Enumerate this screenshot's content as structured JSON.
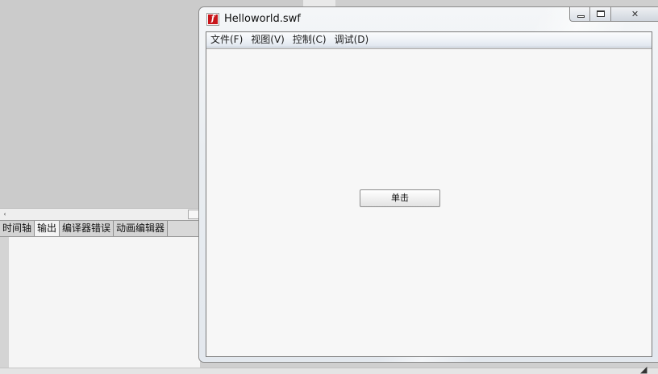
{
  "ide": {
    "scroll_left_arrow": "‹",
    "tabs": [
      {
        "label": "时间轴",
        "active": false
      },
      {
        "label": "输出",
        "active": true
      },
      {
        "label": "编译器错误",
        "active": false
      },
      {
        "label": "动画编辑器",
        "active": false
      }
    ],
    "resize_grip": "◢"
  },
  "swf_window": {
    "title": "Helloworld.swf",
    "icon": "flash-player-icon",
    "controls": {
      "minimize": "minimize-icon",
      "maximize": "maximize-icon",
      "close": "close-icon",
      "close_glyph": "✕"
    },
    "menu": [
      "文件(F)",
      "视图(V)",
      "控制(C)",
      "调试(D)"
    ],
    "stage": {
      "button_label": "单击"
    }
  },
  "colors": {
    "flash_icon_red": "#c8151b",
    "stage_background": "#f7f7f7",
    "ide_background": "#cbcbcb"
  }
}
